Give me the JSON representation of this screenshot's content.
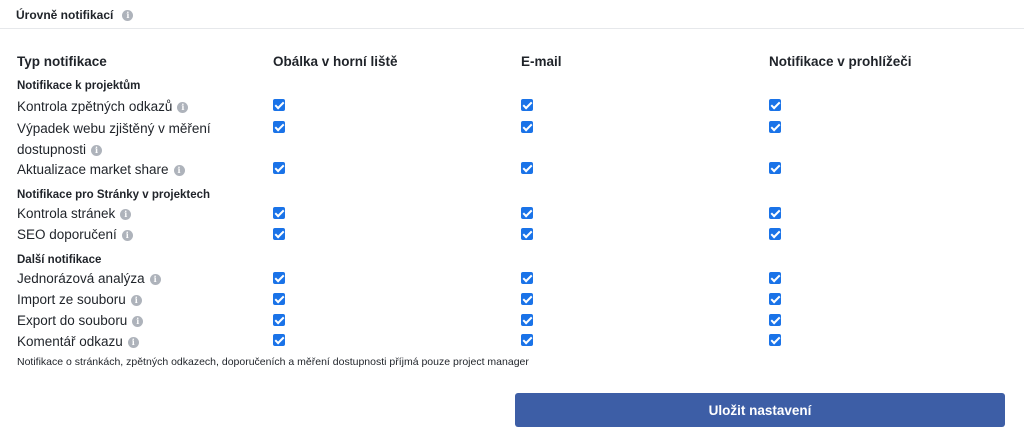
{
  "section": {
    "title": "Úrovně notifikací"
  },
  "columns": {
    "type": "Typ notifikace",
    "envelope": "Obálka v horní liště",
    "email": "E-mail",
    "browser": "Notifikace v prohlížeči"
  },
  "groups": [
    {
      "title": "Notifikace k projektům",
      "rows": [
        {
          "label": "Kontrola zpětných odkazů",
          "envelope": true,
          "email": true,
          "browser": true
        },
        {
          "label_line1": "Výpadek webu zjištěný v měření",
          "label_line2": "dostupnosti",
          "envelope": true,
          "email": true,
          "browser": true
        },
        {
          "label": "Aktualizace market share",
          "envelope": true,
          "email": true,
          "browser": true
        }
      ]
    },
    {
      "title": "Notifikace pro Stránky v projektech",
      "rows": [
        {
          "label": "Kontrola stránek",
          "envelope": true,
          "email": true,
          "browser": true
        },
        {
          "label": "SEO doporučení",
          "envelope": true,
          "email": true,
          "browser": true
        }
      ]
    },
    {
      "title": "Další notifikace",
      "rows": [
        {
          "label": "Jednorázová analýza",
          "envelope": true,
          "email": true,
          "browser": true
        },
        {
          "label": "Import ze souboru",
          "envelope": true,
          "email": true,
          "browser": true
        },
        {
          "label": "Export do souboru",
          "envelope": true,
          "email": true,
          "browser": true
        },
        {
          "label": "Komentář odkazu",
          "envelope": true,
          "email": true,
          "browser": true
        }
      ]
    }
  ],
  "note": "Notifikace o stránkách, zpětných odkazech, doporučeních a měření dostupnosti příjmá pouze project manager",
  "save_button": "Uložit nastavení",
  "colors": {
    "checkbox": "#1a73e8",
    "primary_button": "#3d5ea6",
    "info_icon": "#aeb3bb"
  }
}
